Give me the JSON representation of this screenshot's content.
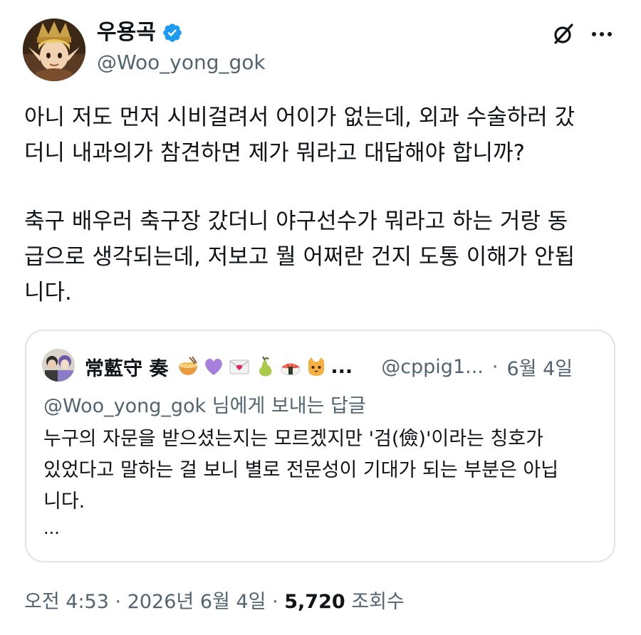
{
  "author": {
    "display_name": "우용곡",
    "handle": "@Woo_yong_gok",
    "verified": true,
    "verified_color": "#1d9bf0"
  },
  "header_actions": {
    "grok_icon": "grok-icon",
    "more_icon": "more-dots-icon"
  },
  "tweet": {
    "paragraphs": [
      "아니 저도 먼저 시비걸려서 어이가 없는데, 외과 수술하러 갔\n더니 내과의가 참견하면 제가 뭐라고 대답해야 합니까?",
      "축구 배우러 축구장 갔더니 야구선수가 뭐라고 하는 거랑 동\n급으로 생각되는데, 저보고 뭘 어쩌란 건지 도통 이해가 안됩\n니다."
    ]
  },
  "quote": {
    "display_name": "常藍守 奏",
    "emojis": [
      "ramen-emoji",
      "purple-heart-emoji",
      "love-letter-emoji",
      "pear-emoji",
      "sushi-emoji",
      "cat-emoji"
    ],
    "ellipsis": "...",
    "handle": "@cppig1...",
    "separator": "·",
    "date": "6월 4일",
    "replying_to": "@Woo_yong_gok 님에게 보내는 답글",
    "text_lines": [
      "누구의 자문을 받으셨는지는 모르겠지만 '검(儉)'이라는 칭호가",
      "있었다고 말하는 걸 보니 별로 전문성이 기대가 되는 부분은 아닙",
      "니다."
    ],
    "more": "..."
  },
  "meta": {
    "time": "오전 4:53",
    "sep1": "·",
    "date": "2026년 6월 4일",
    "sep2": "·",
    "views_count": "5,720",
    "views_label": "조회수"
  },
  "colors": {
    "text": "#0f1419",
    "secondary": "#536471",
    "border": "#dfe3e7",
    "accent": "#1d9bf0"
  }
}
